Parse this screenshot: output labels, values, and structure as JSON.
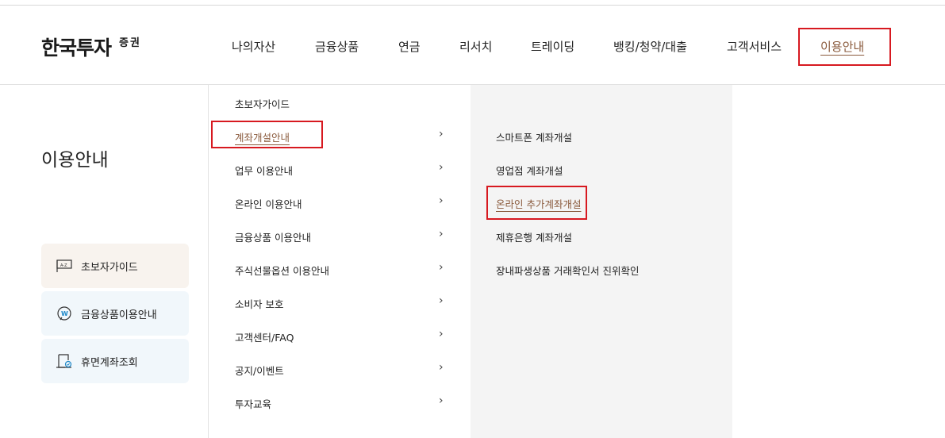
{
  "brand": {
    "main": "한국투자",
    "sub": "증권"
  },
  "gnb": {
    "items": [
      {
        "label": "나의자산"
      },
      {
        "label": "금융상품"
      },
      {
        "label": "연금"
      },
      {
        "label": "리서치"
      },
      {
        "label": "트레이딩"
      },
      {
        "label": "뱅킹/청약/대출"
      },
      {
        "label": "고객서비스"
      },
      {
        "label": "이용안내",
        "active": true
      }
    ]
  },
  "sidebar": {
    "title": "이용안내",
    "quick_links": [
      {
        "label": "초보자가이드",
        "icon": "flag-icon",
        "bg": "#f8f3ee"
      },
      {
        "label": "금융상품이용안내",
        "icon": "won-chat-icon",
        "bg": "#f1f7fb"
      },
      {
        "label": "휴면계좌조회",
        "icon": "account-search-icon",
        "bg": "#f1f7fb"
      }
    ]
  },
  "menu_level1": {
    "items": [
      {
        "label": "초보자가이드",
        "has_sub": false
      },
      {
        "label": "계좌개설안내",
        "has_sub": true,
        "active": true
      },
      {
        "label": "업무 이용안내",
        "has_sub": true
      },
      {
        "label": "온라인 이용안내",
        "has_sub": true
      },
      {
        "label": "금융상품 이용안내",
        "has_sub": true
      },
      {
        "label": "주식선물옵션 이용안내",
        "has_sub": true
      },
      {
        "label": "소비자 보호",
        "has_sub": true
      },
      {
        "label": "고객센터/FAQ",
        "has_sub": true
      },
      {
        "label": "공지/이벤트",
        "has_sub": true
      },
      {
        "label": "투자교육",
        "has_sub": true
      }
    ],
    "chevron": "›"
  },
  "menu_level2": {
    "items": [
      {
        "label": "스마트폰 계좌개설"
      },
      {
        "label": "영업점 계좌개설"
      },
      {
        "label": "온라인 추가계좌개설",
        "active": true
      },
      {
        "label": "제휴은행 계좌개설"
      },
      {
        "label": "장내파생상품 거래확인서 진위확인"
      }
    ]
  },
  "colors": {
    "accent": "#8a5a3c",
    "highlight": "#d71920",
    "submenu_bg": "#f4f4f4"
  }
}
